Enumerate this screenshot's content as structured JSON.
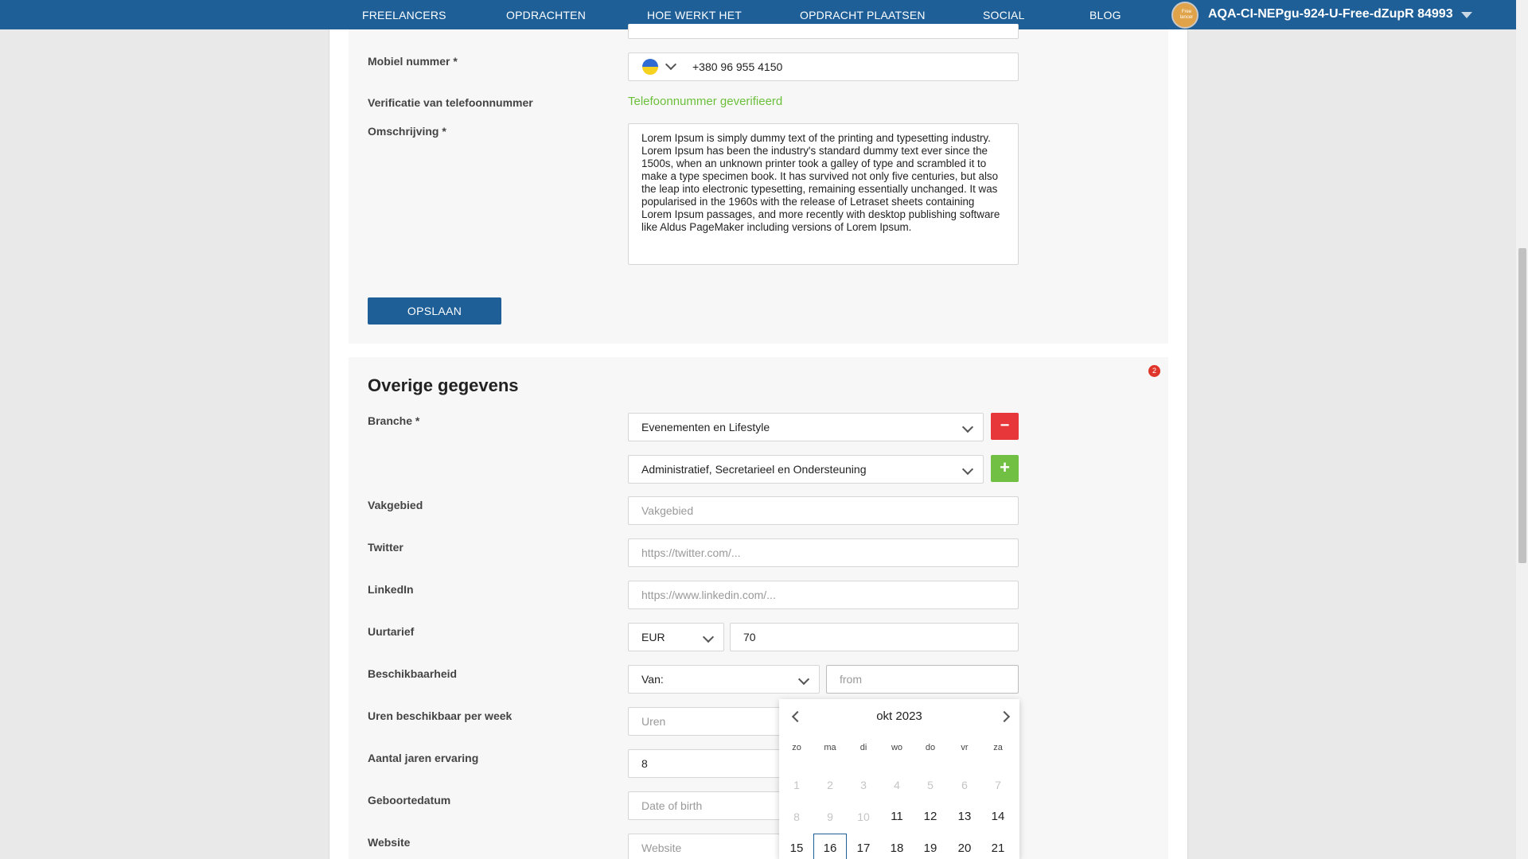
{
  "nav": {
    "items": [
      "FREELANCERS",
      "OPDRACHTEN",
      "HOE WERKT HET",
      "OPDRACHT PLAATSEN",
      "SOCIAL",
      "BLOG"
    ],
    "username": "AQA-CI-NEPgu-924-U-Free-dZupR 84993",
    "avatar_text": "Free lancer"
  },
  "contact": {
    "mobile_label": "Mobiel nummer *",
    "mobile_value": "+380 96 955 4150",
    "verification_label": "Verificatie van telefoonnummer",
    "verification_status": "Telefoonnummer geverifieerd",
    "description_label": "Omschrijving *",
    "description_value": "Lorem Ipsum is simply dummy text of the printing and typesetting industry. Lorem Ipsum has been the industry's standard dummy text ever since the 1500s, when an unknown printer took a galley of type and scrambled it to make a type specimen book. It has survived not only five centuries, but also the leap into electronic typesetting, remaining essentially unchanged. It was popularised in the 1960s with the release of Letraset sheets containing Lorem Ipsum passages, and more recently with desktop publishing software like Aldus PageMaker including versions of Lorem Ipsum.",
    "save_label": "OPSLAAN"
  },
  "other": {
    "title": "Overige gegevens",
    "badge_count": "2",
    "branche_label": "Branche *",
    "branche_1": "Evenementen en Lifestyle",
    "branche_2": "Administratief, Secretarieel en Ondersteuning",
    "remove_symbol": "−",
    "add_symbol": "+",
    "vakgebied_label": "Vakgebied",
    "vakgebied_placeholder": "Vakgebied",
    "twitter_label": "Twitter",
    "twitter_placeholder": "https://twitter.com/...",
    "linkedin_label": "LinkedIn",
    "linkedin_placeholder": "https://www.linkedin.com/...",
    "uurtarief_label": "Uurtarief",
    "currency": "EUR",
    "rate": "70",
    "beschikbaarheid_label": "Beschikbaarheid",
    "beschikbaarheid_select": "Van:",
    "from_placeholder": "from",
    "uren_label": "Uren beschikbaar per week",
    "uren_placeholder": "Uren",
    "ervaring_label": "Aantal jaren ervaring",
    "ervaring_value": "8",
    "geboortedatum_label": "Geboortedatum",
    "geboortedatum_placeholder": "Date of birth",
    "website_label": "Website",
    "website_placeholder": "Website"
  },
  "datepicker": {
    "month": "okt 2023",
    "weekdays": [
      "zo",
      "ma",
      "di",
      "wo",
      "do",
      "vr",
      "za"
    ],
    "rows": [
      [
        "1",
        "2",
        "3",
        "4",
        "5",
        "6",
        "7"
      ],
      [
        "8",
        "9",
        "10",
        "11",
        "12",
        "13",
        "14"
      ],
      [
        "15",
        "16",
        "17",
        "18",
        "19",
        "20",
        "21"
      ]
    ],
    "disabled_through": "10",
    "today": "16"
  }
}
